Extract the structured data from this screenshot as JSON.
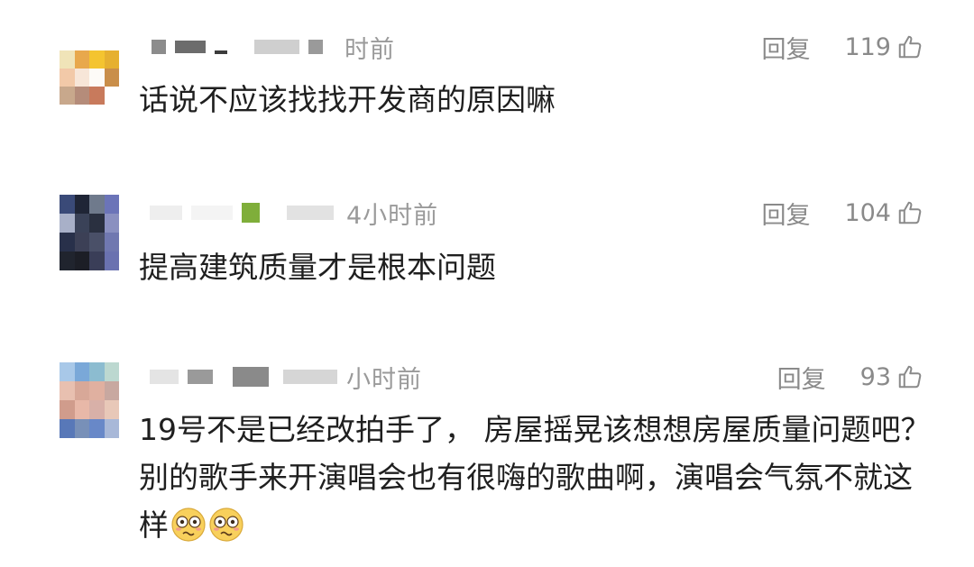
{
  "comments": [
    {
      "time_fragment": "时前",
      "reply_label": "回复",
      "like_count": "119",
      "text": "话说不应该找找开发商的原因嘛",
      "avatar_colors": [
        "#ffffff",
        "#ffffff",
        "#ffffff",
        "#ffffff",
        "#f0e4b8",
        "#e8a84c",
        "#f4c430",
        "#e6b030",
        "#f2c9a8",
        "#f7e6d8",
        "#fdfbf7",
        "#c98e4a",
        "#c8a88c",
        "#b58c7a",
        "#c87a5c",
        "#ffffff"
      ]
    },
    {
      "time_fragment": "4小时前",
      "reply_label": "回复",
      "like_count": "104",
      "text": "提高建筑质量才是根本问题",
      "avatar_colors": [
        "#3a4a78",
        "#1f2536",
        "#6f7a8c",
        "#6b74b8",
        "#a8b0c8",
        "#3a4258",
        "#2a3040",
        "#8a90c0",
        "#28304a",
        "#3c4056",
        "#4a5068",
        "#7078b0",
        "#20242e",
        "#1c1e26",
        "#3a3e58",
        "#6a72b0"
      ]
    },
    {
      "time_fragment": "小时前",
      "reply_label": "回复",
      "like_count": "93",
      "text": "19号不是已经改拍手了， 房屋摇晃该想想房屋质量问题吧？别的歌手来开演唱会也有很嗨的歌曲啊，演唱会气氛不就这样",
      "avatar_colors": [
        "#a8c8e8",
        "#7aa8d8",
        "#8cbcd0",
        "#bcd8d0",
        "#e8c0b0",
        "#d8a898",
        "#e0b0a0",
        "#c8a8a0",
        "#d09c8c",
        "#e8b8a8",
        "#d8b0a8",
        "#e8c8b8",
        "#5878b8",
        "#7890b8",
        "#6888c8",
        "#a8b8d8"
      ]
    }
  ]
}
